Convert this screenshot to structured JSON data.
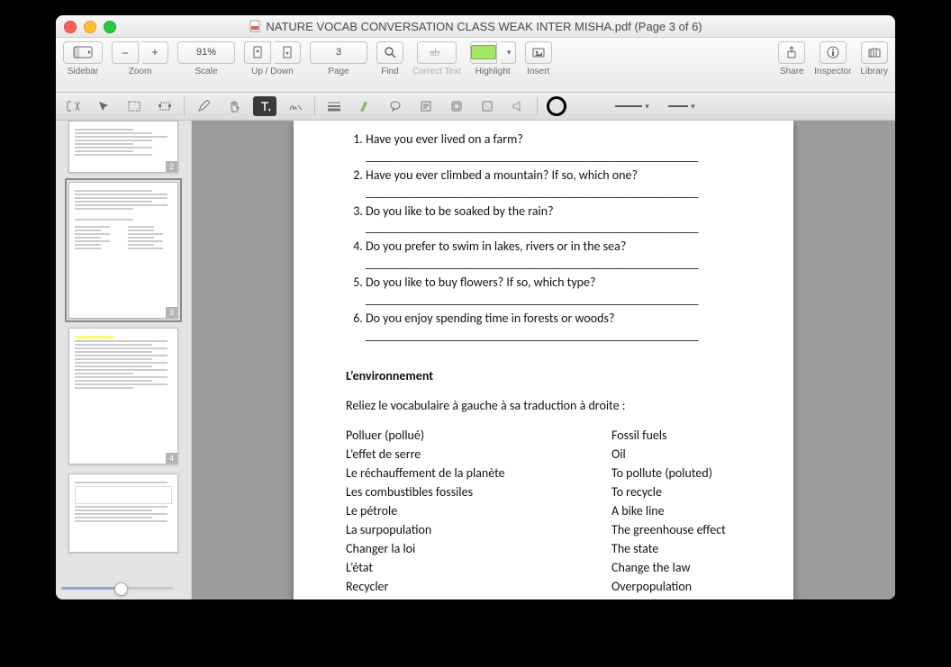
{
  "title": "NATURE VOCAB CONVERSATION CLASS WEAK INTER MISHA.pdf (Page 3 of 6)",
  "toolbar": {
    "sidebar_label": "Sidebar",
    "zoom_label": "Zoom",
    "zoom_minus": "–",
    "zoom_plus": "+",
    "scale_label": "Scale",
    "scale_value": "91%",
    "updown_label": "Up / Down",
    "page_label": "Page",
    "page_value": "3",
    "find_label": "Find",
    "correct_label": "Correct Text",
    "highlight_label": "Highlight",
    "insert_label": "Insert",
    "share_label": "Share",
    "inspector_label": "Inspector",
    "library_label": "Library"
  },
  "thumbs": {
    "p2": "2",
    "p3": "3",
    "p4": "4"
  },
  "doc": {
    "questions": [
      "Have you ever lived on a farm?",
      "Have you ever climbed a mountain? If so, which one?",
      "Do you like to be soaked by the rain?",
      "Do you prefer to swim in lakes, rivers or in the sea?",
      "Do you like to buy flowers? If so, which type?",
      "Do you enjoy spending time in forests or woods?"
    ],
    "blank": "_________________________________________________________",
    "section_title": "L’environnement",
    "instr": "Reliez le vocabulaire à gauche à sa traduction à droite :",
    "left_col": [
      "Polluer (pollué)",
      "L’effet de serre",
      "Le réchauffement de la planète",
      "Les combustibles fossiles",
      "Le pétrole",
      "La surpopulation",
      "Changer la loi",
      "L’état",
      "Recycler"
    ],
    "right_col": [
      "Fossil fuels",
      "Oil",
      "To pollute (poluted)",
      "To recycle",
      "A bike line",
      "The greenhouse effect",
      "The state",
      "Change the law",
      "Overpopulation"
    ]
  }
}
